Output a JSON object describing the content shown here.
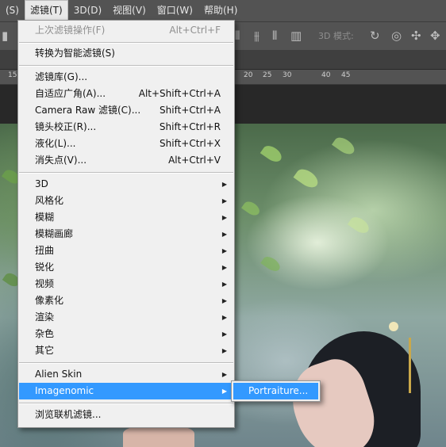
{
  "menubar": {
    "items": [
      {
        "label": "(S)"
      },
      {
        "label": "滤镜(T)"
      },
      {
        "label": "3D(D)"
      },
      {
        "label": "视图(V)"
      },
      {
        "label": "窗口(W)"
      },
      {
        "label": "帮助(H)"
      }
    ]
  },
  "options_bar": {
    "mode_3d_label": "3D 模式:"
  },
  "ruler": {
    "ticks": [
      "15",
      "20",
      "25",
      "30",
      "40",
      "45"
    ]
  },
  "filter_menu": {
    "items": [
      {
        "label": "上次滤镜操作(F)",
        "shortcut": "Alt+Ctrl+F"
      },
      {
        "label": "转换为智能滤镜(S)"
      },
      {
        "label": "滤镜库(G)..."
      },
      {
        "label": "自适应广角(A)...",
        "shortcut": "Alt+Shift+Ctrl+A"
      },
      {
        "label": "Camera Raw 滤镜(C)...",
        "shortcut": "Shift+Ctrl+A"
      },
      {
        "label": "镜头校正(R)...",
        "shortcut": "Shift+Ctrl+R"
      },
      {
        "label": "液化(L)...",
        "shortcut": "Shift+Ctrl+X"
      },
      {
        "label": "消失点(V)...",
        "shortcut": "Alt+Ctrl+V"
      },
      {
        "label": "3D"
      },
      {
        "label": "风格化"
      },
      {
        "label": "模糊"
      },
      {
        "label": "模糊画廊"
      },
      {
        "label": "扭曲"
      },
      {
        "label": "锐化"
      },
      {
        "label": "视频"
      },
      {
        "label": "像素化"
      },
      {
        "label": "渲染"
      },
      {
        "label": "杂色"
      },
      {
        "label": "其它"
      },
      {
        "label": "Alien Skin"
      },
      {
        "label": "Imagenomic"
      },
      {
        "label": "浏览联机滤镜..."
      }
    ]
  },
  "submenu": {
    "items": [
      {
        "label": "Portraiture..."
      }
    ]
  }
}
